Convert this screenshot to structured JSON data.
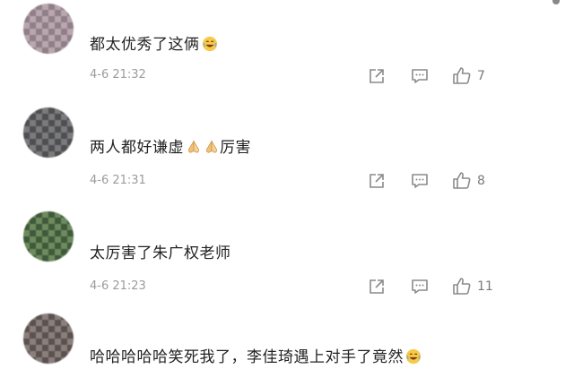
{
  "comments": [
    {
      "text": "都太优秀了这俩",
      "emoji": "laughing-emoji",
      "time": "4-6 21:32",
      "likes": "7"
    },
    {
      "text_before": "两人都好谦虚",
      "text_after": "厉害",
      "emoji": "praying-hands-emoji",
      "time": "4-6 21:31",
      "likes": "8"
    },
    {
      "text": "太厉害了朱广权老师",
      "time": "4-6 21:23",
      "likes": "11"
    },
    {
      "text": "哈哈哈哈哈笑死我了，李佳琦遇上对手了竟然",
      "emoji": "laughing-emoji"
    }
  ],
  "colors": {
    "text": "#222222",
    "meta": "#9b9b9b",
    "icon": "#8a8a8a"
  }
}
